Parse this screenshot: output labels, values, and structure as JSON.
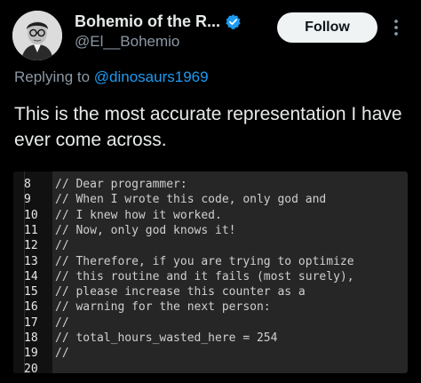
{
  "author": {
    "name": "Bohemio of the R...",
    "handle": "@El__Bohemio",
    "avatar_icon": "profile-photo",
    "verified_icon": "verified-badge-icon",
    "verified_color": "#1d9bf0"
  },
  "follow_button": {
    "label": "Follow"
  },
  "more_icon": "vertical-ellipsis-icon",
  "reply": {
    "prefix": "Replying to ",
    "mention": "@dinosaurs1969"
  },
  "tweet_text": "This is the most accurate representation I have ever come across.",
  "code_snippet": {
    "lines": [
      {
        "number": "8",
        "text": "// Dear programmer:"
      },
      {
        "number": "9",
        "text": "// When I wrote this code, only god and"
      },
      {
        "number": "10",
        "text": "// I knew how it worked."
      },
      {
        "number": "11",
        "text": "// Now, only god knows it!"
      },
      {
        "number": "12",
        "text": "//"
      },
      {
        "number": "13",
        "text": "// Therefore, if you are trying to optimize"
      },
      {
        "number": "14",
        "text": "// this routine and it fails (most surely),"
      },
      {
        "number": "15",
        "text": "// please increase this counter as a"
      },
      {
        "number": "16",
        "text": "// warning for the next person:"
      },
      {
        "number": "17",
        "text": "//"
      },
      {
        "number": "18",
        "text": "// total_hours_wasted_here = 254"
      },
      {
        "number": "19",
        "text": "//"
      },
      {
        "number": "20",
        "text": ""
      }
    ]
  },
  "colors": {
    "background": "#000000",
    "text_primary": "#e7e9ea",
    "text_secondary": "#8b98a5",
    "link": "#1d9bf0",
    "code_background": "#262626"
  }
}
